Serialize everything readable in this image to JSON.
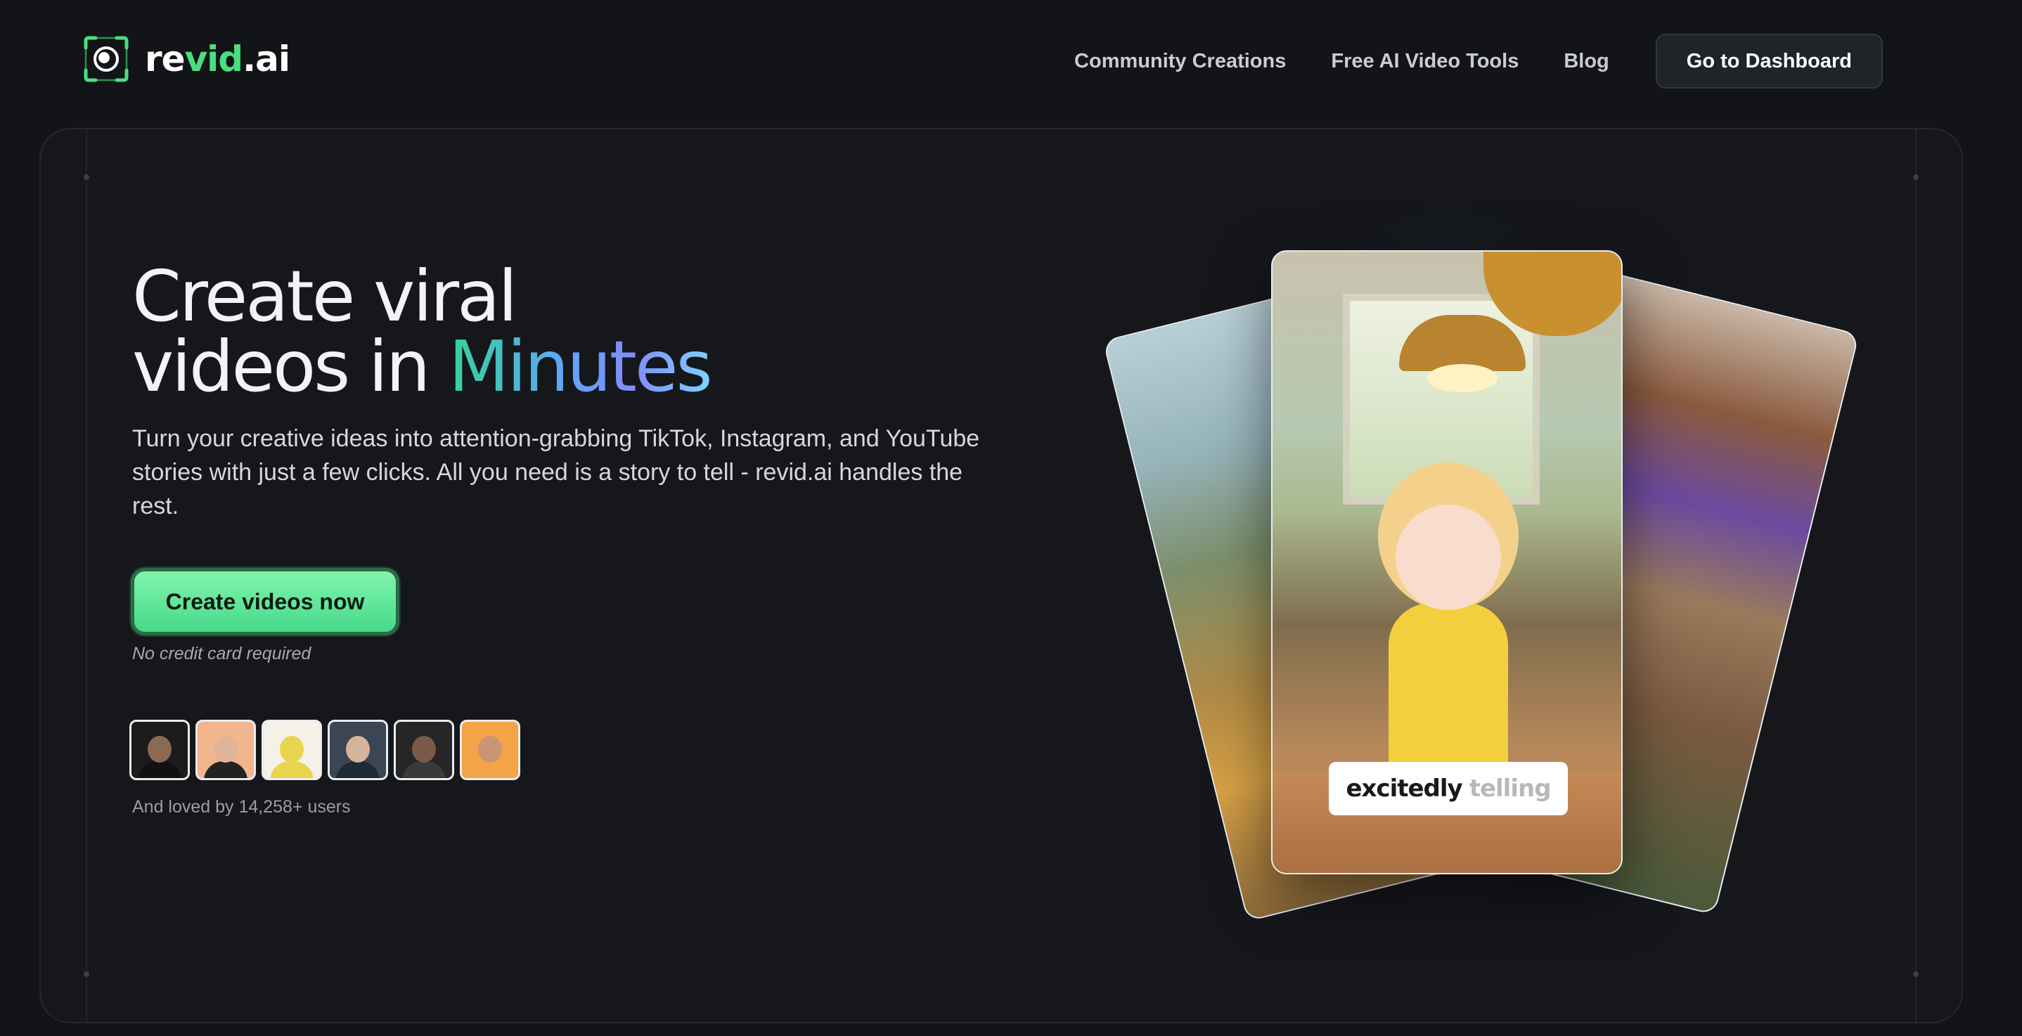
{
  "brand": {
    "name_part1": "re",
    "name_part2": "vid",
    "name_part3": ".ai",
    "accent": "#4ade80"
  },
  "nav": {
    "links": [
      "Community Creations",
      "Free AI Video Tools",
      "Blog"
    ],
    "dashboard_button": "Go to Dashboard"
  },
  "hero": {
    "headline_line1": "Create viral",
    "headline_line2_prefix": "videos in ",
    "headline_highlight": "Minutes",
    "subtitle": "Turn your creative ideas into attention-grabbing TikTok, Instagram, and YouTube stories with just a few clicks. All you need is a story to tell - revid.ai handles the rest.",
    "cta_label": "Create videos now",
    "cta_note": "No credit card required",
    "social_proof": "And loved by 14,258+ users"
  },
  "avatars": [
    {
      "bg": "#1c1c1c",
      "skin": "#8a6a55",
      "shirt": "#111111"
    },
    {
      "bg": "#f2b58e",
      "skin": "#e0b49a",
      "shirt": "#222222"
    },
    {
      "bg": "#f4f1e6",
      "skin": "#e8d44d",
      "shirt": "#e8d44d"
    },
    {
      "bg": "#3b4654",
      "skin": "#d6b49c",
      "shirt": "#1f2a36"
    },
    {
      "bg": "#262626",
      "skin": "#7a5a48",
      "shirt": "#3a3a3a"
    },
    {
      "bg": "#f5a347",
      "skin": "#c99574",
      "shirt": "#f5a347"
    }
  ],
  "video_card": {
    "caption_word1": "excitedly",
    "caption_word2": "telling"
  }
}
